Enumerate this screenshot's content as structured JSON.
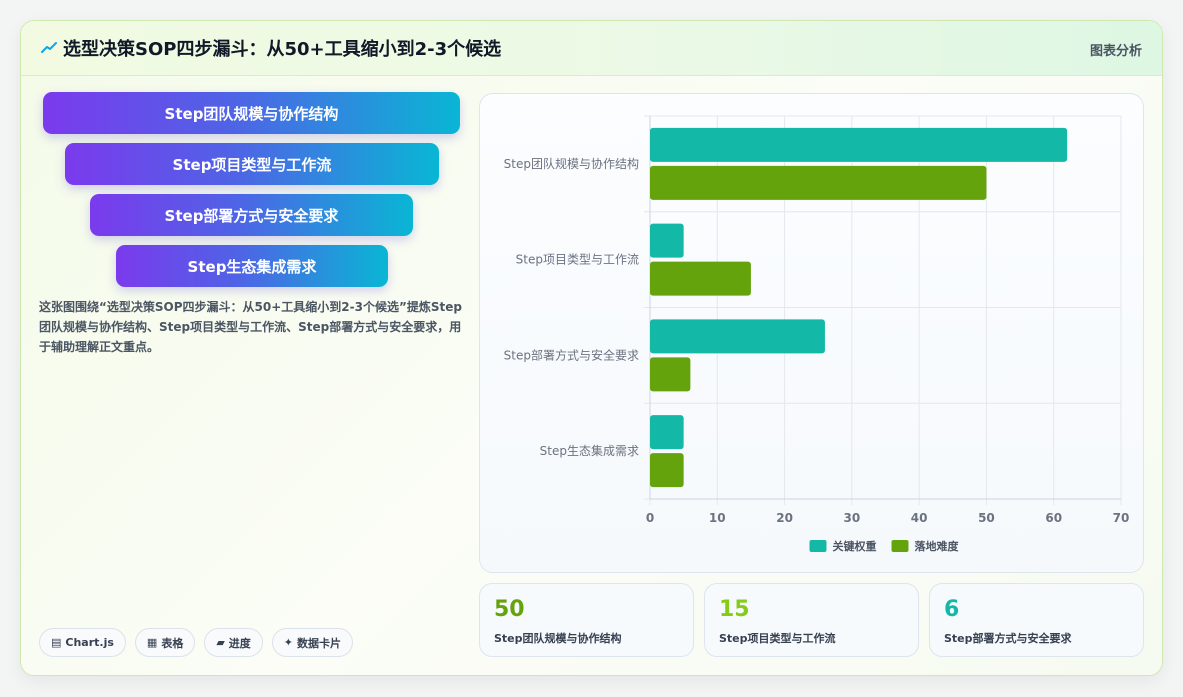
{
  "header": {
    "title": "选型决策SOP四步漏斗：从50+工具缩小到2-3个候选",
    "tag": "图表分析"
  },
  "funnel": {
    "steps": [
      "Step团队规模与协作结构",
      "Step项目类型与工作流",
      "Step部署方式与安全要求",
      "Step生态集成需求"
    ]
  },
  "description": "这张图围绕“选型决策SOP四步漏斗：从50+工具缩小到2-3个候选”提炼Step团队规模与协作结构、Step项目类型与工作流、Step部署方式与安全要求，用于辅助理解正文重点。",
  "chips": [
    {
      "icon": "chart-icon",
      "glyph": "▤",
      "label": "Chart.js"
    },
    {
      "icon": "table-icon",
      "glyph": "▦",
      "label": "表格"
    },
    {
      "icon": "progress-icon",
      "glyph": "▰",
      "label": "进度"
    },
    {
      "icon": "sparkle-icon",
      "glyph": "✦",
      "label": "数据卡片"
    }
  ],
  "stats": [
    {
      "value": "50",
      "label": "Step团队规模与协作结构",
      "color": "#65a30d"
    },
    {
      "value": "15",
      "label": "Step项目类型与工作流",
      "color": "#84cc16"
    },
    {
      "value": "6",
      "label": "Step部署方式与安全要求",
      "color": "#14b8a6"
    }
  ],
  "chart_data": {
    "type": "bar",
    "orientation": "horizontal",
    "categories": [
      "Step团队规模与协作结构",
      "Step项目类型与工作流",
      "Step部署方式与安全要求",
      "Step生态集成需求"
    ],
    "series": [
      {
        "name": "关键权重",
        "values": [
          62,
          5,
          26,
          5
        ],
        "color": "#14b8a6"
      },
      {
        "name": "落地难度",
        "values": [
          50,
          15,
          6,
          5
        ],
        "color": "#65a30d"
      }
    ],
    "xlim": [
      0,
      70
    ],
    "xticks": [
      0,
      10,
      20,
      30,
      40,
      50,
      60,
      70
    ],
    "grid": true,
    "legend": "bottom"
  }
}
